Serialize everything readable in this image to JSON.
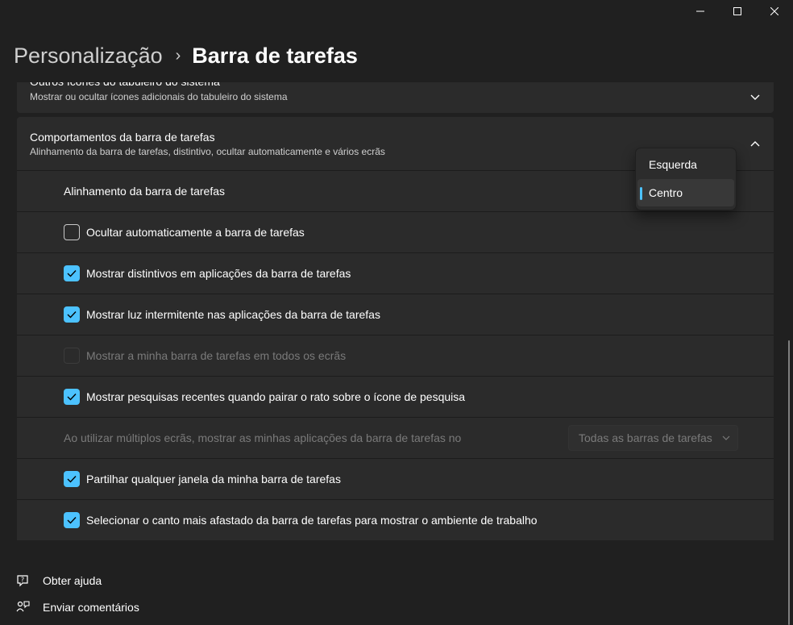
{
  "window": {
    "controls": [
      "minimize",
      "maximize",
      "close"
    ]
  },
  "breadcrumb": {
    "parent": "Personalização",
    "separator": "›",
    "current": "Barra de tarefas"
  },
  "tray_card": {
    "title": "Outros ícones do tabuleiro do sistema",
    "subtitle": "Mostrar ou ocultar ícones adicionais do tabuleiro do sistema",
    "expanded": false
  },
  "behaviors_card": {
    "title": "Comportamentos da barra de tarefas",
    "subtitle": "Alinhamento da barra de tarefas, distintivo, ocultar automaticamente e vários ecrãs",
    "expanded": true,
    "alignment": {
      "label": "Alinhamento da barra de tarefas",
      "options": [
        "Esquerda",
        "Centro"
      ],
      "selected": "Centro"
    },
    "options": [
      {
        "label": "Ocultar automaticamente a barra de tarefas",
        "checked": false,
        "enabled": true
      },
      {
        "label": "Mostrar distintivos em aplicações da barra de tarefas",
        "checked": true,
        "enabled": true
      },
      {
        "label": "Mostrar luz intermitente nas aplicações da barra de tarefas",
        "checked": true,
        "enabled": true
      },
      {
        "label": "Mostrar a minha barra de tarefas em todos os ecrãs",
        "checked": false,
        "enabled": false
      },
      {
        "label": "Mostrar pesquisas recentes quando pairar o rato sobre o ícone de pesquisa",
        "checked": true,
        "enabled": true
      }
    ],
    "multi_display": {
      "label": "Ao utilizar múltiplos ecrãs, mostrar as minhas aplicações da barra de tarefas no",
      "value": "Todas as barras de tarefas",
      "enabled": false
    },
    "options_2": [
      {
        "label": "Partilhar qualquer janela da minha barra de tarefas",
        "checked": true,
        "enabled": true
      },
      {
        "label": "Selecionar o canto mais afastado da barra de tarefas para mostrar o ambiente de trabalho",
        "checked": true,
        "enabled": true
      }
    ]
  },
  "footer_links": [
    {
      "label": "Obter ajuda",
      "icon": "help-icon"
    },
    {
      "label": "Enviar comentários",
      "icon": "feedback-icon"
    }
  ],
  "colors": {
    "background": "#202020",
    "card": "#2b2b2b",
    "accent": "#4cc2ff",
    "text_primary": "#ffffff",
    "text_secondary": "#cfcfcf",
    "text_disabled": "#7a7a7a"
  }
}
